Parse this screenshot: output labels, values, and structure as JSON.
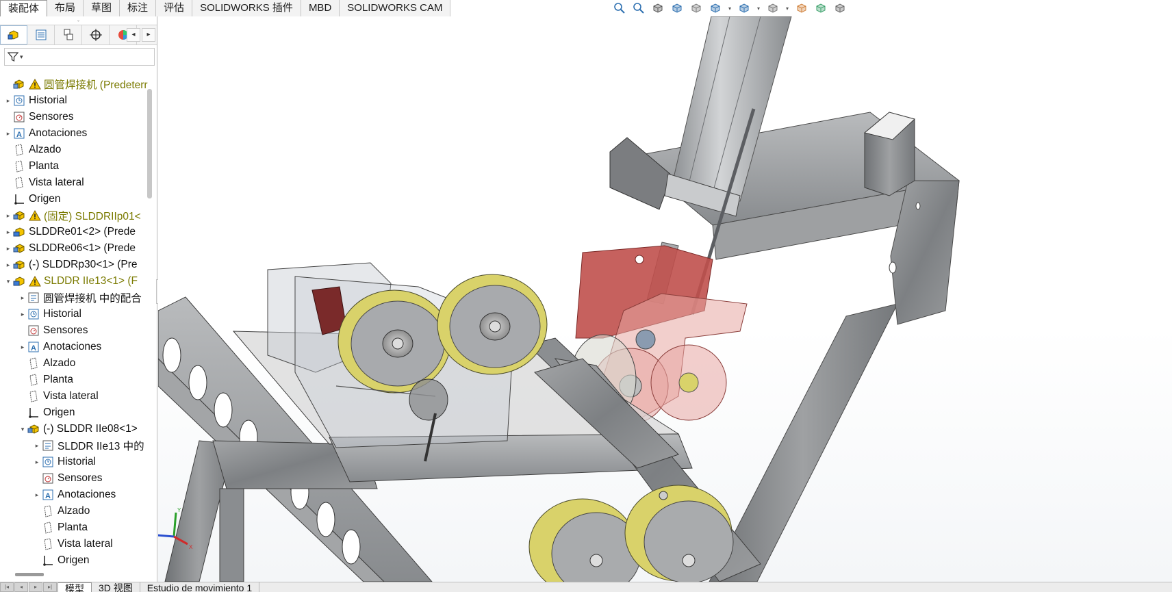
{
  "command_tabs": [
    "装配体",
    "布局",
    "草图",
    "标注",
    "评估",
    "SOLIDWORKS 插件",
    "MBD",
    "SOLIDWORKS CAM"
  ],
  "active_command_tab": "装配体",
  "hud_icons": [
    "zoom-to-fit-icon",
    "zoom-to-area-icon",
    "previous-view-icon",
    "section-view-icon",
    "dynamic-annotation-icon",
    "view-orientation-icon",
    "display-style-icon",
    "hide-show-items-icon",
    "edit-appearance-icon",
    "apply-scene-icon",
    "view-settings-icon"
  ],
  "panel_tabs": [
    "featuremanager-icon",
    "propertymanager-icon",
    "configurationmanager-icon",
    "dimxpertmanager-icon",
    "displaymanager-icon"
  ],
  "panel_handle": "◦",
  "scroll_left": "◂",
  "scroll_right": "▸",
  "filter_caret": "▾",
  "tree": [
    {
      "label": "圆管焊接机  (Predeterr",
      "icon": "assembly-icon",
      "warn": true,
      "expand": "",
      "indent": 0,
      "color": "olive"
    },
    {
      "label": "Historial",
      "icon": "history-icon",
      "warn": false,
      "expand": "▸",
      "indent": 0
    },
    {
      "label": "Sensores",
      "icon": "sensor-icon",
      "warn": false,
      "expand": "",
      "indent": 0
    },
    {
      "label": "Anotaciones",
      "icon": "annotations-icon",
      "warn": false,
      "expand": "▸",
      "indent": 0
    },
    {
      "label": "Alzado",
      "icon": "plane-icon",
      "warn": false,
      "expand": "",
      "indent": 0
    },
    {
      "label": "Planta",
      "icon": "plane-icon",
      "warn": false,
      "expand": "",
      "indent": 0
    },
    {
      "label": "Vista lateral",
      "icon": "plane-icon",
      "warn": false,
      "expand": "",
      "indent": 0
    },
    {
      "label": "Origen",
      "icon": "origin-icon",
      "warn": false,
      "expand": "",
      "indent": 0
    },
    {
      "label": "(固定) SLDDRIIp01<",
      "icon": "subassembly-icon",
      "warn": true,
      "expand": "▸",
      "indent": 0,
      "color": "olive"
    },
    {
      "label": "SLDDRe01<2> (Prede",
      "icon": "subassembly-edit-icon",
      "warn": false,
      "expand": "▸",
      "indent": 0
    },
    {
      "label": "SLDDRe06<1> (Prede",
      "icon": "subassembly-icon",
      "warn": false,
      "expand": "▸",
      "indent": 0
    },
    {
      "label": "(-) SLDDRp30<1> (Pre",
      "icon": "subassembly-icon",
      "warn": false,
      "expand": "▸",
      "indent": 0
    },
    {
      "label": "SLDDR IIe13<1> (F",
      "icon": "subassembly-edit-icon",
      "warn": true,
      "expand": "▾",
      "indent": 0,
      "color": "olive"
    },
    {
      "label": "圆管焊接机 中的配合",
      "icon": "mates-icon",
      "warn": false,
      "expand": "▸",
      "indent": 1
    },
    {
      "label": "Historial",
      "icon": "history-icon",
      "warn": false,
      "expand": "▸",
      "indent": 1
    },
    {
      "label": "Sensores",
      "icon": "sensor-icon",
      "warn": false,
      "expand": "",
      "indent": 1
    },
    {
      "label": "Anotaciones",
      "icon": "annotations-icon",
      "warn": false,
      "expand": "▸",
      "indent": 1
    },
    {
      "label": "Alzado",
      "icon": "plane-icon",
      "warn": false,
      "expand": "",
      "indent": 1
    },
    {
      "label": "Planta",
      "icon": "plane-icon",
      "warn": false,
      "expand": "",
      "indent": 1
    },
    {
      "label": "Vista lateral",
      "icon": "plane-icon",
      "warn": false,
      "expand": "",
      "indent": 1
    },
    {
      "label": "Origen",
      "icon": "origin-icon",
      "warn": false,
      "expand": "",
      "indent": 1
    },
    {
      "label": "(-) SLDDR IIe08<1>",
      "icon": "subassembly-icon",
      "warn": false,
      "expand": "▾",
      "indent": 1
    },
    {
      "label": "SLDDR IIe13 中的",
      "icon": "mates-icon",
      "warn": false,
      "expand": "▸",
      "indent": 2
    },
    {
      "label": "Historial",
      "icon": "history-icon",
      "warn": false,
      "expand": "▸",
      "indent": 2
    },
    {
      "label": "Sensores",
      "icon": "sensor-icon",
      "warn": false,
      "expand": "",
      "indent": 2
    },
    {
      "label": "Anotaciones",
      "icon": "annotations-icon",
      "warn": false,
      "expand": "▸",
      "indent": 2
    },
    {
      "label": "Alzado",
      "icon": "plane-icon",
      "warn": false,
      "expand": "",
      "indent": 2
    },
    {
      "label": "Planta",
      "icon": "plane-icon",
      "warn": false,
      "expand": "",
      "indent": 2
    },
    {
      "label": "Vista lateral",
      "icon": "plane-icon",
      "warn": false,
      "expand": "",
      "indent": 2
    },
    {
      "label": "Origen",
      "icon": "origin-icon",
      "warn": false,
      "expand": "",
      "indent": 2
    }
  ],
  "bottom_tabs": [
    "模型",
    "3D 视图",
    "Estudio de movimiento 1"
  ],
  "active_bottom_tab": "模型",
  "nav_arrows": [
    "|◂",
    "◂",
    "▸",
    "▸|"
  ],
  "triad_labels": {
    "y": "Y",
    "z": "Z",
    "x": "X"
  },
  "colors": {
    "warning": "#f5c400",
    "olive_text": "#7a7a00",
    "steel": "#8d8f91",
    "wheel_yellow": "#d9d26a",
    "bracket_red": "#c0504d"
  }
}
